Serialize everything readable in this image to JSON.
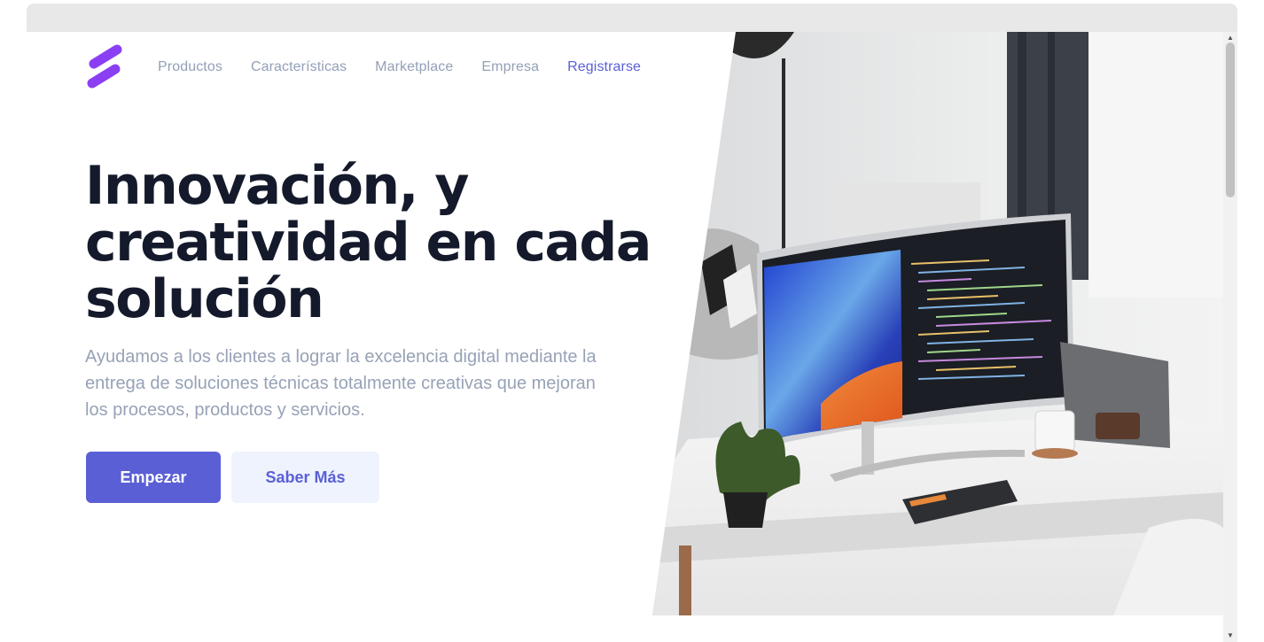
{
  "nav": {
    "items": [
      {
        "label": "Productos"
      },
      {
        "label": "Características"
      },
      {
        "label": "Marketplace"
      },
      {
        "label": "Empresa"
      },
      {
        "label": "Registrarse"
      }
    ]
  },
  "hero": {
    "title": "Innovación, y creatividad en cada solución",
    "subtitle": "Ayudamos a los clientes a lograr la excelencia digital mediante la entrega de soluciones técnicas totalmente creativas que mejoran los procesos, productos y servicios.",
    "primary_button": "Empezar",
    "secondary_button": "Saber Más"
  },
  "colors": {
    "accent": "#5a5fd6",
    "logo": "#8b3ff2",
    "title": "#141a2b",
    "muted": "#94a0b8",
    "secondary_bg": "#eef3fe"
  },
  "icons": {
    "logo": "brand-logo-icon",
    "scroll_up": "scroll-up-icon",
    "scroll_down": "scroll-down-icon"
  }
}
